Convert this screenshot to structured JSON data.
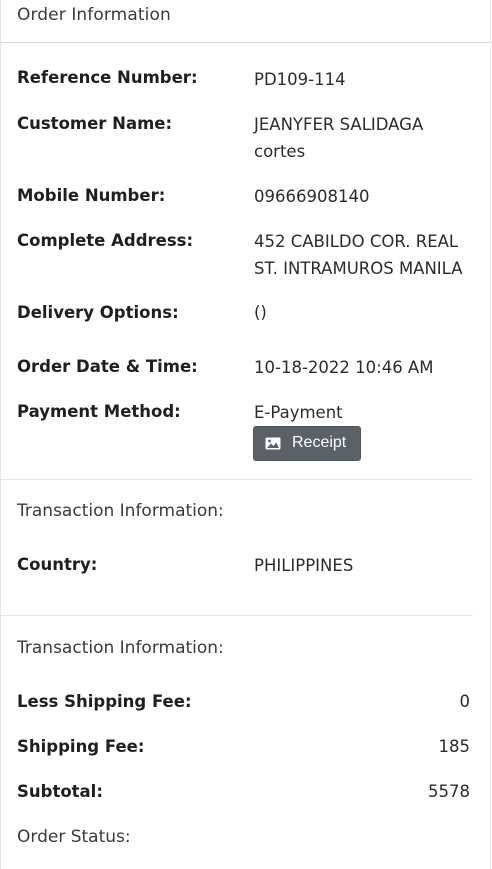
{
  "header": {
    "title": "Order Information"
  },
  "order": {
    "reference_label": "Reference Number:",
    "reference_value": "PD109-114",
    "customer_label": "Customer Name:",
    "customer_line1": "JEANYFER SALIDAGA",
    "customer_line2": "cortes",
    "mobile_label": "Mobile Number:",
    "mobile_value": "09666908140",
    "address_label": "Complete Address:",
    "address_line1": "452 CABILDO COR. REAL",
    "address_line2": "ST. INTRAMUROS MANILA",
    "delivery_label": "Delivery Options:",
    "delivery_value": "()",
    "datetime_label": "Order Date & Time:",
    "datetime_value": "10-18-2022 10:46 AM",
    "payment_label": "Payment Method:",
    "payment_value": "E-Payment",
    "receipt_button": "Receipt",
    "receipt_icon": "image-icon"
  },
  "transaction1": {
    "title": "Transaction Information:",
    "country_label": "Country:",
    "country_value": "PHILIPPINES"
  },
  "transaction2": {
    "title": "Transaction Information:",
    "less_shipping_label": "Less Shipping Fee:",
    "less_shipping_value": "0",
    "shipping_label": "Shipping Fee:",
    "shipping_value": "185",
    "subtotal_label": "Subtotal:",
    "subtotal_value": "5578"
  },
  "status": {
    "label": "Order Status:"
  },
  "colors": {
    "button_bg": "#5a6268",
    "text": "#212529",
    "divider": "#e6e6e6"
  }
}
